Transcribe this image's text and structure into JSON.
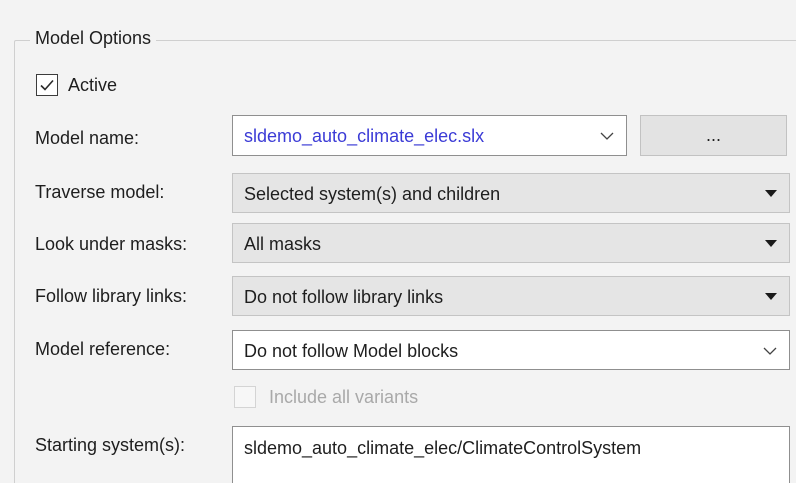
{
  "group": {
    "title": "Model Options"
  },
  "active": {
    "label": "Active",
    "checked": true
  },
  "model_name": {
    "label": "Model name:",
    "value": "sldemo_auto_climate_elec.slx",
    "browse_label": "..."
  },
  "traverse_model": {
    "label": "Traverse model:",
    "value": "Selected system(s) and children"
  },
  "look_under_masks": {
    "label": "Look under masks:",
    "value": "All masks"
  },
  "follow_library_links": {
    "label": "Follow library links:",
    "value": "Do not follow library links"
  },
  "model_reference": {
    "label": "Model reference:",
    "value": "Do not follow Model blocks"
  },
  "include_all_variants": {
    "label": "Include all variants",
    "checked": false,
    "enabled": false
  },
  "starting_system": {
    "label": "Starting system(s):",
    "value": "sldemo_auto_climate_elec/ClimateControlSystem"
  },
  "colors": {
    "link_text": "#3b3bd6",
    "panel_bg": "#f3f3f3",
    "combo_grey": "#e5e5e5"
  },
  "icons": {
    "dropdown_solid": "triangle-down",
    "dropdown_open": "chevron-down",
    "check": "check-mark"
  }
}
